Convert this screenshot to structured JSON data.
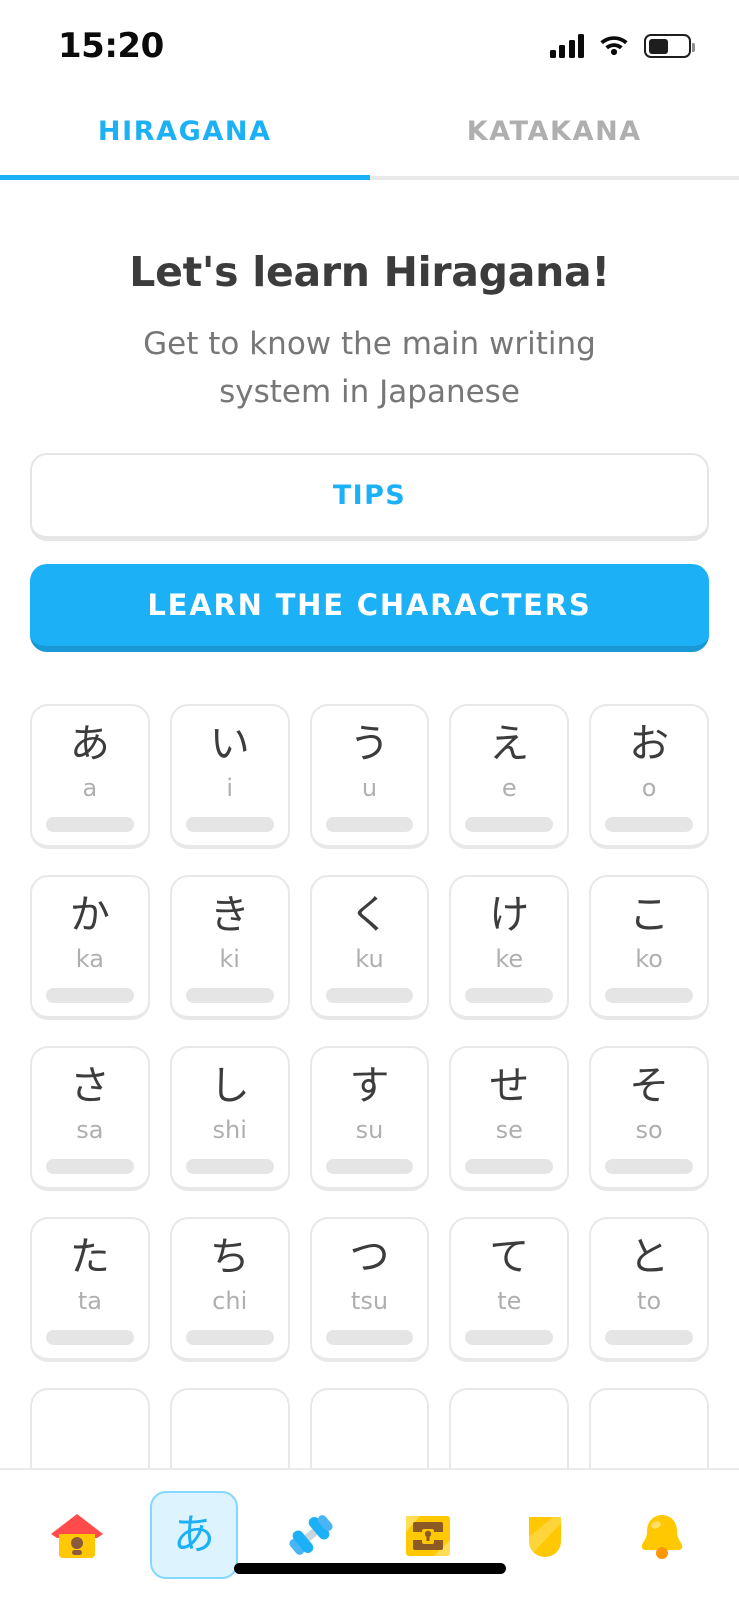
{
  "status_bar": {
    "time": "15:20",
    "signal_icon": "cellular-signal-icon",
    "wifi_icon": "wifi-icon",
    "battery_icon": "battery-icon",
    "battery_level_percent": 45
  },
  "tabs": [
    {
      "label": "HIRAGANA",
      "active": true
    },
    {
      "label": "KATAKANA",
      "active": false
    }
  ],
  "header": {
    "title": "Let's learn Hiragana!",
    "subtitle": "Get to know the main writing system in Japanese"
  },
  "buttons": {
    "tips_label": "TIPS",
    "learn_label": "LEARN THE CHARACTERS"
  },
  "colors": {
    "accent_blue": "#1cb0f6",
    "accent_blue_dark": "#1899d6",
    "text_dark": "#3c3c3c",
    "text_gray": "#777777",
    "muted_gray": "#afafaf",
    "border_gray": "#e5e5e5",
    "nav_selected_bg": "#ddf4ff",
    "gold": "#ffc800"
  },
  "character_grid": {
    "rows": [
      [
        {
          "char": "あ",
          "romaji": "a",
          "progress": 0
        },
        {
          "char": "い",
          "romaji": "i",
          "progress": 0
        },
        {
          "char": "う",
          "romaji": "u",
          "progress": 0
        },
        {
          "char": "え",
          "romaji": "e",
          "progress": 0
        },
        {
          "char": "お",
          "romaji": "o",
          "progress": 0
        }
      ],
      [
        {
          "char": "か",
          "romaji": "ka",
          "progress": 0
        },
        {
          "char": "き",
          "romaji": "ki",
          "progress": 0
        },
        {
          "char": "く",
          "romaji": "ku",
          "progress": 0
        },
        {
          "char": "け",
          "romaji": "ke",
          "progress": 0
        },
        {
          "char": "こ",
          "romaji": "ko",
          "progress": 0
        }
      ],
      [
        {
          "char": "さ",
          "romaji": "sa",
          "progress": 0
        },
        {
          "char": "し",
          "romaji": "shi",
          "progress": 0
        },
        {
          "char": "す",
          "romaji": "su",
          "progress": 0
        },
        {
          "char": "せ",
          "romaji": "se",
          "progress": 0
        },
        {
          "char": "そ",
          "romaji": "so",
          "progress": 0
        }
      ],
      [
        {
          "char": "た",
          "romaji": "ta",
          "progress": 0
        },
        {
          "char": "ち",
          "romaji": "chi",
          "progress": 0
        },
        {
          "char": "つ",
          "romaji": "tsu",
          "progress": 0
        },
        {
          "char": "て",
          "romaji": "te",
          "progress": 0
        },
        {
          "char": "と",
          "romaji": "to",
          "progress": 0
        }
      ],
      [
        {
          "char": "",
          "romaji": "",
          "progress": 0
        },
        {
          "char": "",
          "romaji": "",
          "progress": 0
        },
        {
          "char": "",
          "romaji": "",
          "progress": 0
        },
        {
          "char": "",
          "romaji": "",
          "progress": 0
        },
        {
          "char": "",
          "romaji": "",
          "progress": 0
        }
      ]
    ]
  },
  "bottom_nav": {
    "items": [
      {
        "icon": "home-birdhouse-icon",
        "selected": false
      },
      {
        "icon": "alphabet-hiragana-icon",
        "selected": true
      },
      {
        "icon": "dumbbell-practice-icon",
        "selected": false
      },
      {
        "icon": "treasure-chest-icon",
        "selected": false
      },
      {
        "icon": "shield-leagues-icon",
        "selected": false
      },
      {
        "icon": "bell-notifications-icon",
        "selected": false
      }
    ]
  }
}
